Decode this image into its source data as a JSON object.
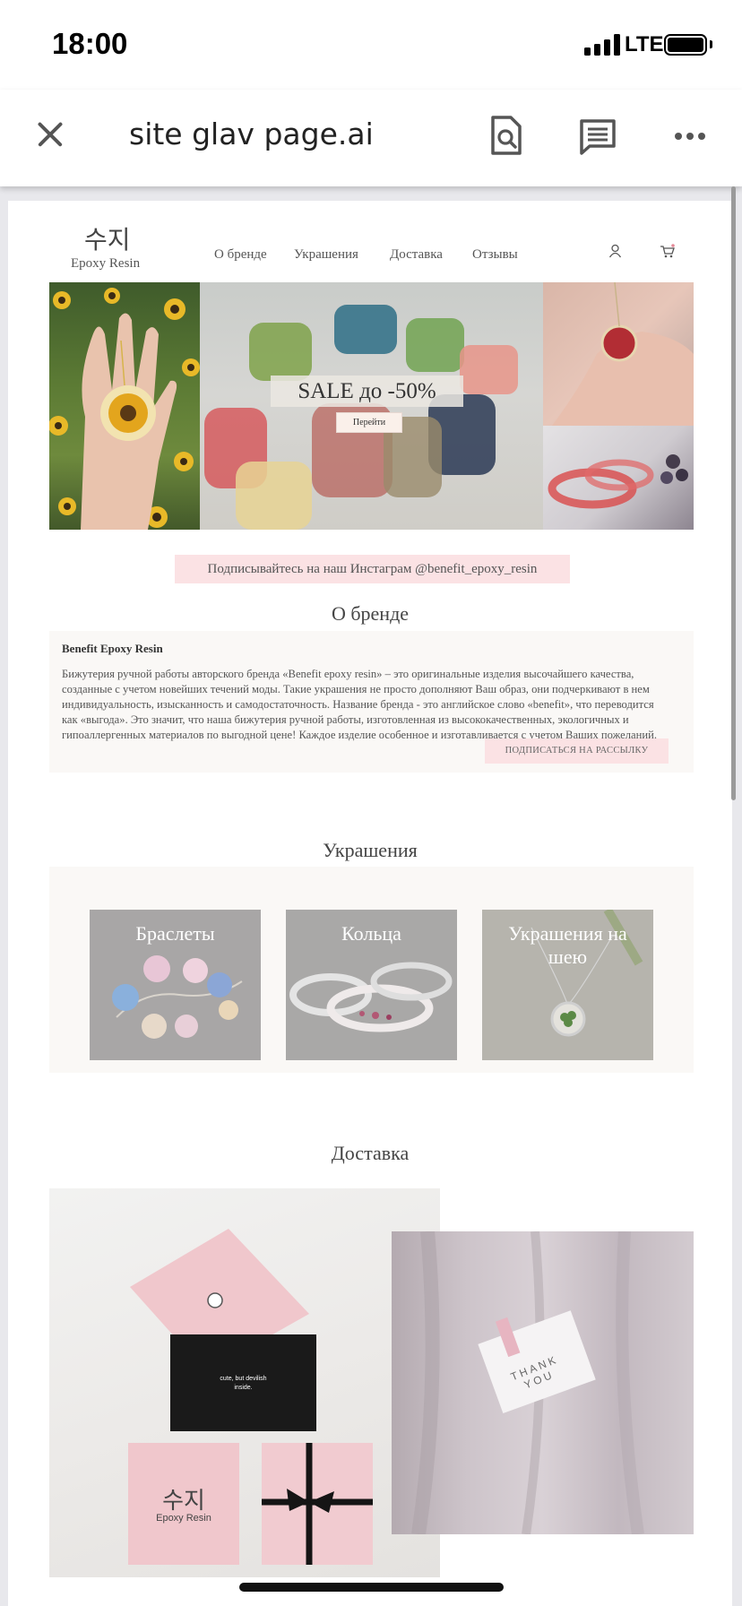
{
  "status_bar": {
    "time": "18:00",
    "network": "LTE"
  },
  "toolbar": {
    "title": "site glav page.ai"
  },
  "site": {
    "logo": {
      "korean": "수지",
      "english": "Epoxy Resin"
    },
    "nav": [
      "О бренде",
      "Украшения",
      "Доставка",
      "Отзывы"
    ],
    "hero": {
      "sale": "SALE до -50%",
      "button": "Перейти"
    },
    "instagram": "Подписывайтесь на наш Инстаграм @benefit_epoxy_resin",
    "about": {
      "title": "О бренде",
      "heading": "Benefit Epoxy Resin",
      "text": "Бижутерия ручной работы авторского бренда «Benefit epoxy resin» – это оригинальные изделия высочайшего качества, созданные с учетом новейших течений моды. Такие украшения не просто дополняют Ваш образ, они подчеркивают в нем индивидуальность, изысканность и самодостаточность. Название бренда - это английское слово «benefit», что переводится как «выгода». Это значит, что наша бижутерия ручной работы, изготовленная из высококачественных, экологичных и гипоаллергенных материалов по выгодной цене! Каждое изделие особенное и изготавливается с учетом Ваших пожеланий.",
      "subscribe": "ПОДПИСАТЬСЯ НА РАССЫЛКУ"
    },
    "jewelry": {
      "title": "Украшения",
      "categories": [
        "Браслеты",
        "Кольца",
        "Украшения на шею"
      ]
    },
    "delivery": {
      "title": "Доставка",
      "card_text": "cute, but devilish inside.",
      "box_logo_kr": "수지",
      "box_logo_en": "Epoxy Resin",
      "thank_you": "THANK YOU"
    }
  },
  "colors": {
    "accent_pink": "#fbe2e4",
    "panel_bg": "#faf8f6",
    "viewer_bg": "#e8e8ec"
  }
}
